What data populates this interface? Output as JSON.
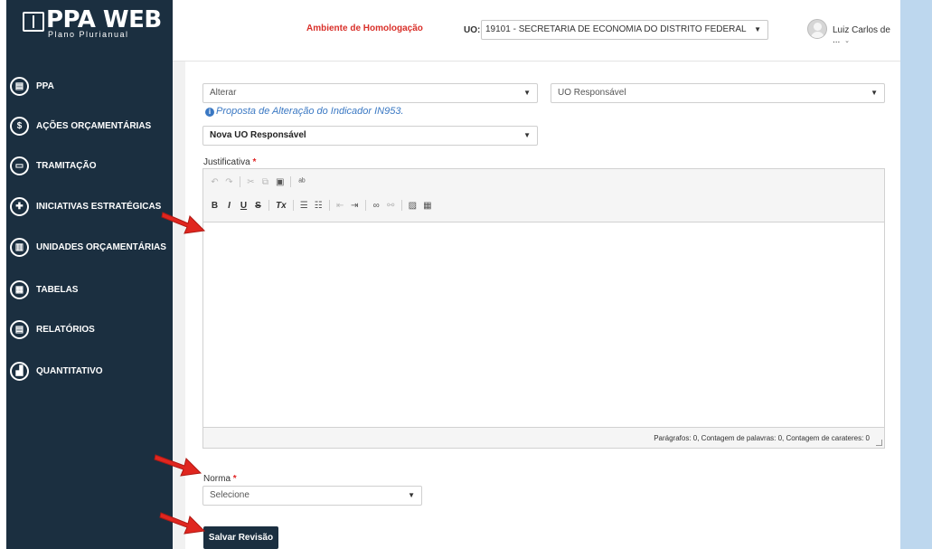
{
  "app": {
    "logo_title": "PPA WEB",
    "logo_subtitle": "Plano Plurianual"
  },
  "topbar": {
    "environment": "Ambiente de Homologação",
    "uo_label": "UO:",
    "uo_value": "19101 - SECRETARIA DE ECONOMIA DO DISTRITO FEDERAL",
    "user_name": "Luiz Carlos de ..."
  },
  "sidebar": {
    "items": [
      {
        "label": "PPA",
        "icon": "book-icon",
        "glyph": "▤"
      },
      {
        "label": "AÇÕES ORÇAMENTÁRIAS",
        "icon": "dollar-icon",
        "glyph": "$"
      },
      {
        "label": "TRAMITAÇÃO",
        "icon": "inbox-icon",
        "glyph": "▭"
      },
      {
        "label": "INICIATIVAS ESTRATÉGICAS",
        "icon": "puzzle-icon",
        "glyph": "✚"
      },
      {
        "label": "UNIDADES ORÇAMENTÁRIAS",
        "icon": "bank-icon",
        "glyph": "▥"
      },
      {
        "label": "TABELAS",
        "icon": "table-icon",
        "glyph": "▦"
      },
      {
        "label": "RELATÓRIOS",
        "icon": "report-icon",
        "glyph": "▤"
      },
      {
        "label": "QUANTITATIVO",
        "icon": "bar-chart-icon",
        "glyph": "▟"
      }
    ]
  },
  "form": {
    "action_select": "Alterar",
    "responsible_select": "UO Responsável",
    "info_text": "Proposta de Alteração do Indicador IN953.",
    "new_uo_select": "Nova UO Responsável",
    "justification_label": "Justificativa",
    "required_mark": "*",
    "counter_text": "Parágrafos: 0, Contagem de palavras: 0, Contagem de carateres: 0",
    "norma_label": "Norma",
    "norma_select": "Selecione",
    "save_button": "Salvar Revisão"
  },
  "colors": {
    "sidebar_bg": "#1b2f40",
    "env_red": "#d9302a",
    "info_blue": "#3a78c3",
    "right_band": "#bdd7ee",
    "arrow_red": "#e0261f"
  }
}
